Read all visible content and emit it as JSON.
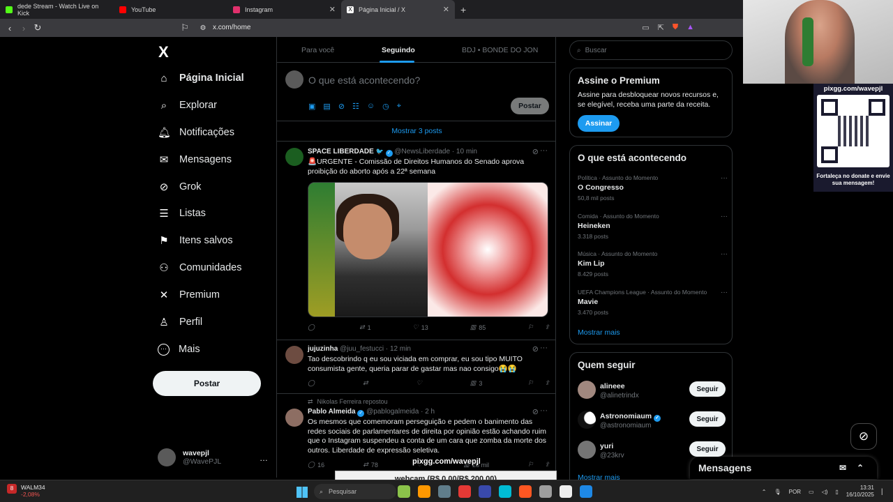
{
  "browser": {
    "tabs": [
      {
        "title": "dede Stream - Watch Live on Kick",
        "color": "#53fc18"
      },
      {
        "title": "YouTube",
        "color": "#ff0000"
      },
      {
        "title": "Instagram",
        "color": "#e1306c"
      },
      {
        "title": "Página Inicial / X",
        "color": "#000000"
      }
    ],
    "new_tab": "+",
    "url": "x.com/home"
  },
  "leftnav": {
    "logo": "X",
    "items": [
      {
        "label": "Página Inicial",
        "icon": "home-icon",
        "glyph": "⌂"
      },
      {
        "label": "Explorar",
        "icon": "search-icon",
        "glyph": "⌕"
      },
      {
        "label": "Notificações",
        "icon": "bell-icon",
        "glyph": "♫"
      },
      {
        "label": "Mensagens",
        "icon": "mail-icon",
        "glyph": "✉"
      },
      {
        "label": "Grok",
        "icon": "grok-icon",
        "glyph": "⊘"
      },
      {
        "label": "Listas",
        "icon": "list-icon",
        "glyph": "☰"
      },
      {
        "label": "Itens salvos",
        "icon": "bookmark-icon",
        "glyph": "⚑"
      },
      {
        "label": "Comunidades",
        "icon": "communities-icon",
        "glyph": "⚇"
      },
      {
        "label": "Premium",
        "icon": "x-premium-icon",
        "glyph": "✕"
      },
      {
        "label": "Perfil",
        "icon": "profile-icon",
        "glyph": "♙"
      },
      {
        "label": "Mais",
        "icon": "more-icon",
        "glyph": "⋯"
      }
    ],
    "post_button": "Postar",
    "account": {
      "name": "wavepjl",
      "handle": "@WavePJL",
      "more": "…"
    }
  },
  "feed": {
    "tabs": [
      "Para você",
      "Seguindo",
      "BDJ • BONDE DO JON"
    ],
    "compose_placeholder": "O que está acontecendo?",
    "compose_post": "Postar",
    "show_more": "Mostrar 3 posts",
    "tweets": [
      {
        "name": "SPACE LIBERDADE",
        "badge": "🐦",
        "handle": "@NewsLiberdade",
        "time": "· 10 min",
        "text": "🚨URGENTE - Comissão de Direitos Humanos do Senado aprova proibição do aborto após a 22ª semana",
        "replies": "",
        "retweets": "1",
        "likes": "13",
        "views": "85"
      },
      {
        "name": "jujuzinha",
        "handle": "@juu_festucci",
        "time": "· 12 min",
        "text": "Tao descobrindo q eu sou viciada em comprar, eu sou tipo MUITO consumista gente, queria parar de gastar mas nao consigo😭😭",
        "replies": "",
        "retweets": "",
        "likes": "",
        "views": "3"
      },
      {
        "retweeted_by": "Nikolas Ferreira repostou",
        "name": "Pablo Almeida",
        "handle": "@pablogalmeida",
        "time": "· 2 h",
        "text": "Os mesmos que comemoram perseguição e pedem o banimento das redes sociais de parlamentares de direita por opinião estão achando ruim que o Instagram suspendeu a conta de um cara que zomba da morte dos outros. Liberdade de expressão seletiva.",
        "replies": "16",
        "retweets": "78",
        "likes": "",
        "views": "28 mil"
      }
    ]
  },
  "right": {
    "search_placeholder": "Buscar",
    "premium": {
      "title": "Assine o Premium",
      "text": "Assine para desbloquear novos recursos e, se elegível, receba uma parte da receita.",
      "button": "Assinar"
    },
    "trends": {
      "title": "O que está acontecendo",
      "items": [
        {
          "category": "Política · Assunto do Momento",
          "name": "O Congresso",
          "count": "50,8 mil posts"
        },
        {
          "category": "Comida · Assunto do Momento",
          "name": "Heineken",
          "count": "3.318 posts"
        },
        {
          "category": "Música · Assunto do Momento",
          "name": "Kim Lip",
          "count": "8.429 posts"
        },
        {
          "category": "UEFA Champions League · Assunto do Momento",
          "name": "Mavie",
          "count": "3.470 posts"
        }
      ],
      "show_more": "Mostrar mais"
    },
    "follow": {
      "title": "Quem seguir",
      "items": [
        {
          "name": "alineee",
          "handle": "@alinetrindx",
          "button": "Seguir",
          "verified": false
        },
        {
          "name": "Astronomiaum",
          "handle": "@astronomiaum",
          "button": "Seguir",
          "verified": true
        },
        {
          "name": "yuri",
          "handle": "@23krv",
          "button": "Seguir",
          "verified": false
        }
      ],
      "show_more": "Mostrar mais"
    },
    "messages_drawer": "Mensagens"
  },
  "stream_overlay": {
    "qr_url": "pixgg.com/wavepjl",
    "qr_caption": "Fortaleça no donate e envie sua mensagem!",
    "bottom_url": "pixgg.com/wavepjl",
    "webcam_goal": "webcam (R$ 0,00/R$ 200,00)"
  },
  "taskbar": {
    "stock_name": "WALM34",
    "stock_change": "-2,08%",
    "stock_badge": "8",
    "search_placeholder": "Pesquisar",
    "language": "POR",
    "time": "13:31",
    "date": "16/10/2025",
    "app_colors": [
      "#8bc34a",
      "#ff9800",
      "#607d8b",
      "#e53935",
      "#3949ab",
      "#00bcd4",
      "#ff5722",
      "#9e9e9e",
      "#eeeeee",
      "#1e88e5"
    ]
  }
}
